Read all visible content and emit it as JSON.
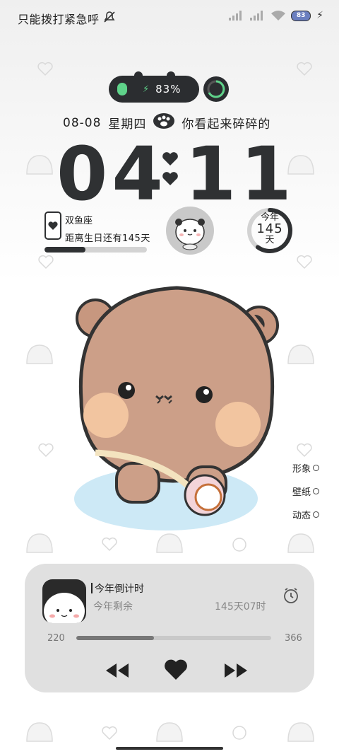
{
  "status_bar": {
    "carrier_text": "只能拨打紧急呼",
    "mute_icon": "bell-off-icon",
    "battery_level": "83"
  },
  "charge_widget": {
    "percent_text": "83%"
  },
  "date_row": {
    "date": "08-08",
    "weekday": "星期四",
    "mood_text": "你看起来碎碎的"
  },
  "clock": {
    "hours": "04",
    "minutes": "11"
  },
  "zodiac": {
    "sign": "双鱼座",
    "birthday_text": "距离生日还有145天",
    "progress": 0.4
  },
  "year_widget": {
    "top": "今年",
    "number": "145",
    "unit": "天",
    "progress": 0.6
  },
  "side_menu": {
    "items": [
      "形象",
      "壁纸",
      "动态"
    ]
  },
  "music_card": {
    "title": "今年倒计时",
    "subtitle": "今年剩余",
    "remaining": "145天07时",
    "start_value": "220",
    "end_value": "366",
    "progress": 0.4
  },
  "colors": {
    "accent_dark": "#2f3133",
    "charge_green": "#5fd38a",
    "card_bg": "#e0e0e0"
  }
}
